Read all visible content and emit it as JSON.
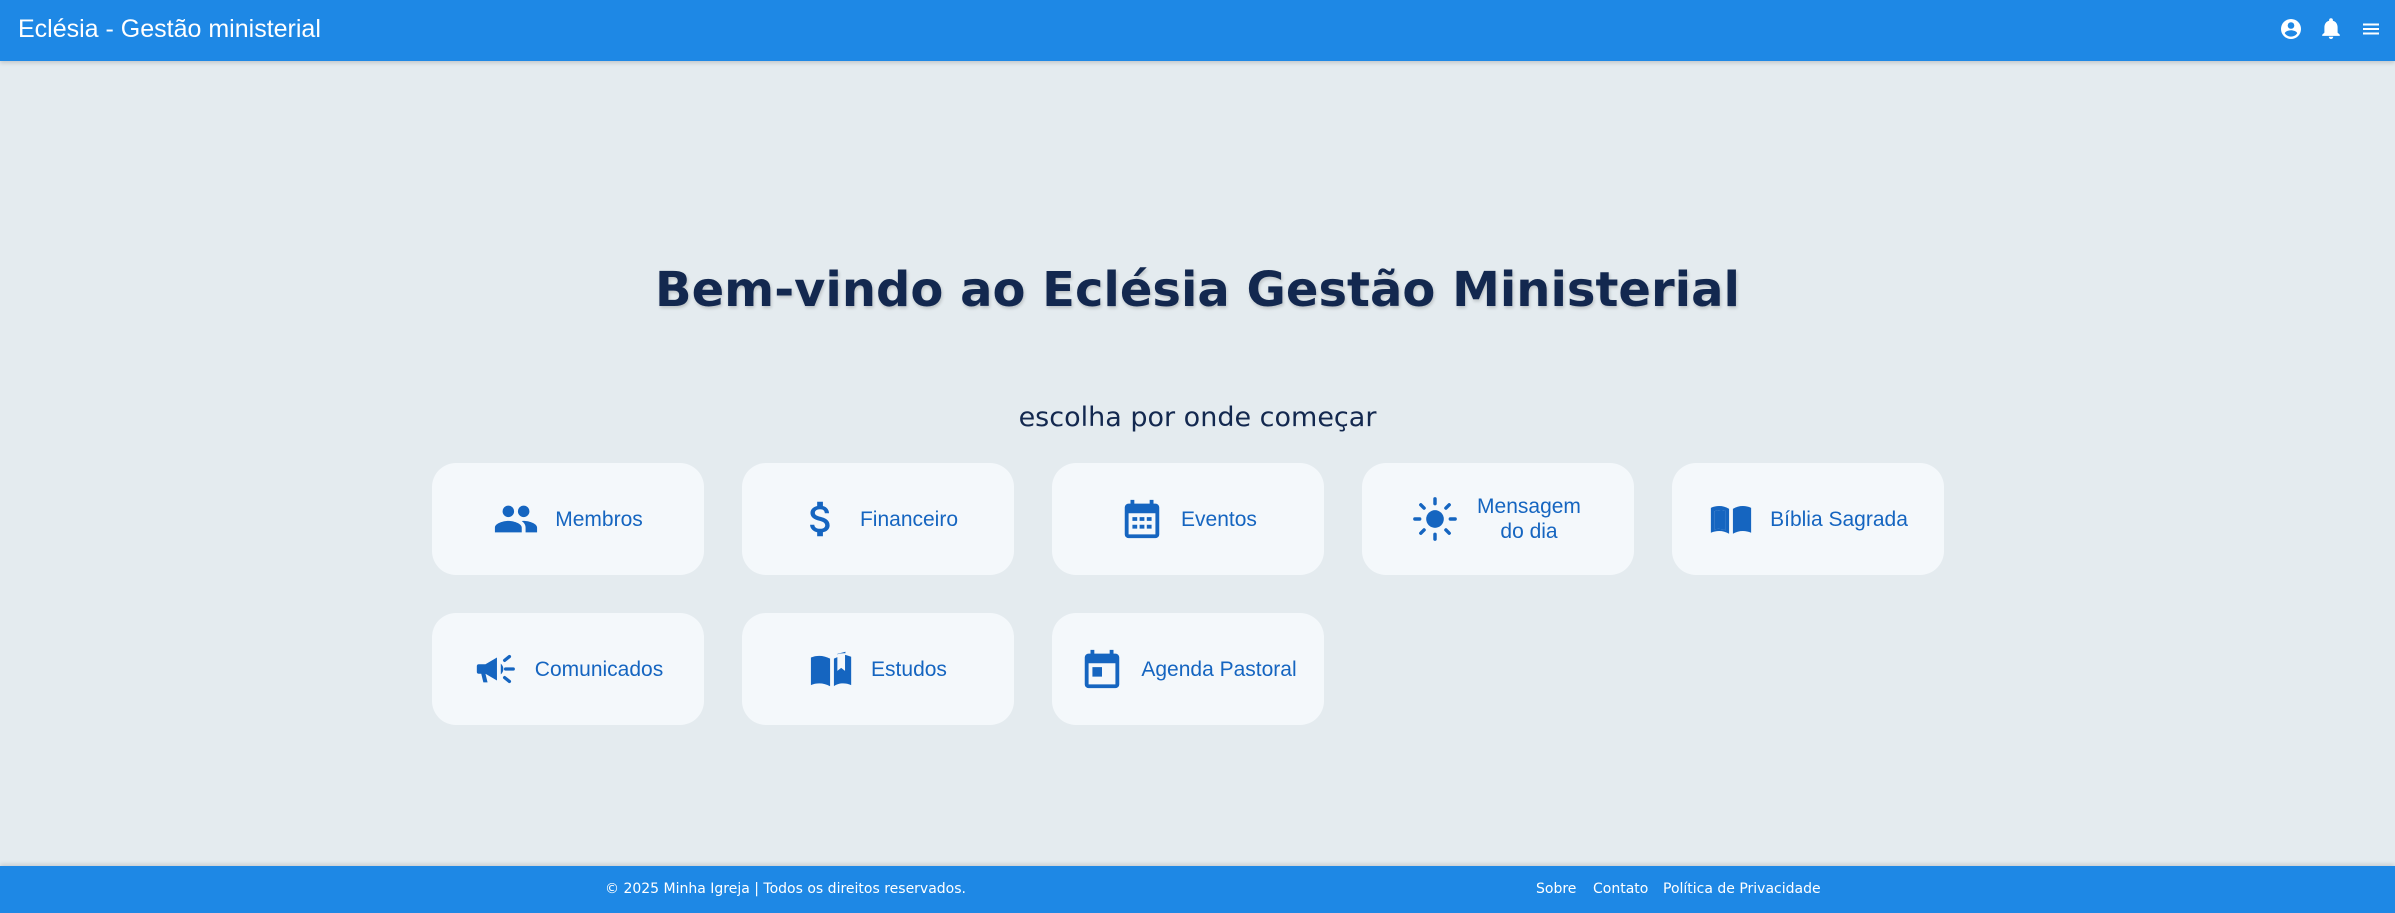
{
  "app": {
    "title": "Eclésia - Gestão ministerial"
  },
  "header": {
    "icons": [
      "account-circle-icon",
      "bell-icon",
      "menu-icon"
    ]
  },
  "main": {
    "title": "Bem-vindo ao Eclésia Gestão Ministerial",
    "subtitle": "escolha por onde começar",
    "cards": [
      {
        "label": "Membros",
        "icon": "people-icon"
      },
      {
        "label": "Financeiro",
        "icon": "dollar-icon"
      },
      {
        "label": "Eventos",
        "icon": "calendar-grid-icon"
      },
      {
        "label": "Mensagem do dia",
        "icon": "sun-icon"
      },
      {
        "label": "Bíblia Sagrada",
        "icon": "open-book-icon"
      },
      {
        "label": "Comunicados",
        "icon": "megaphone-icon"
      },
      {
        "label": "Estudos",
        "icon": "book-bookmark-icon"
      },
      {
        "label": "Agenda Pastoral",
        "icon": "calendar-event-icon"
      }
    ]
  },
  "footer": {
    "copyright": "© 2025 Minha Igreja | Todos os direitos reservados.",
    "links": [
      "Sobre",
      "Contato",
      "Política de Privacidade"
    ]
  },
  "colors": {
    "primary": "#1e88e5",
    "background": "#e4ebef",
    "card": "#f4f8fb",
    "accent_text": "#1565c0",
    "title_text": "#13284f"
  }
}
